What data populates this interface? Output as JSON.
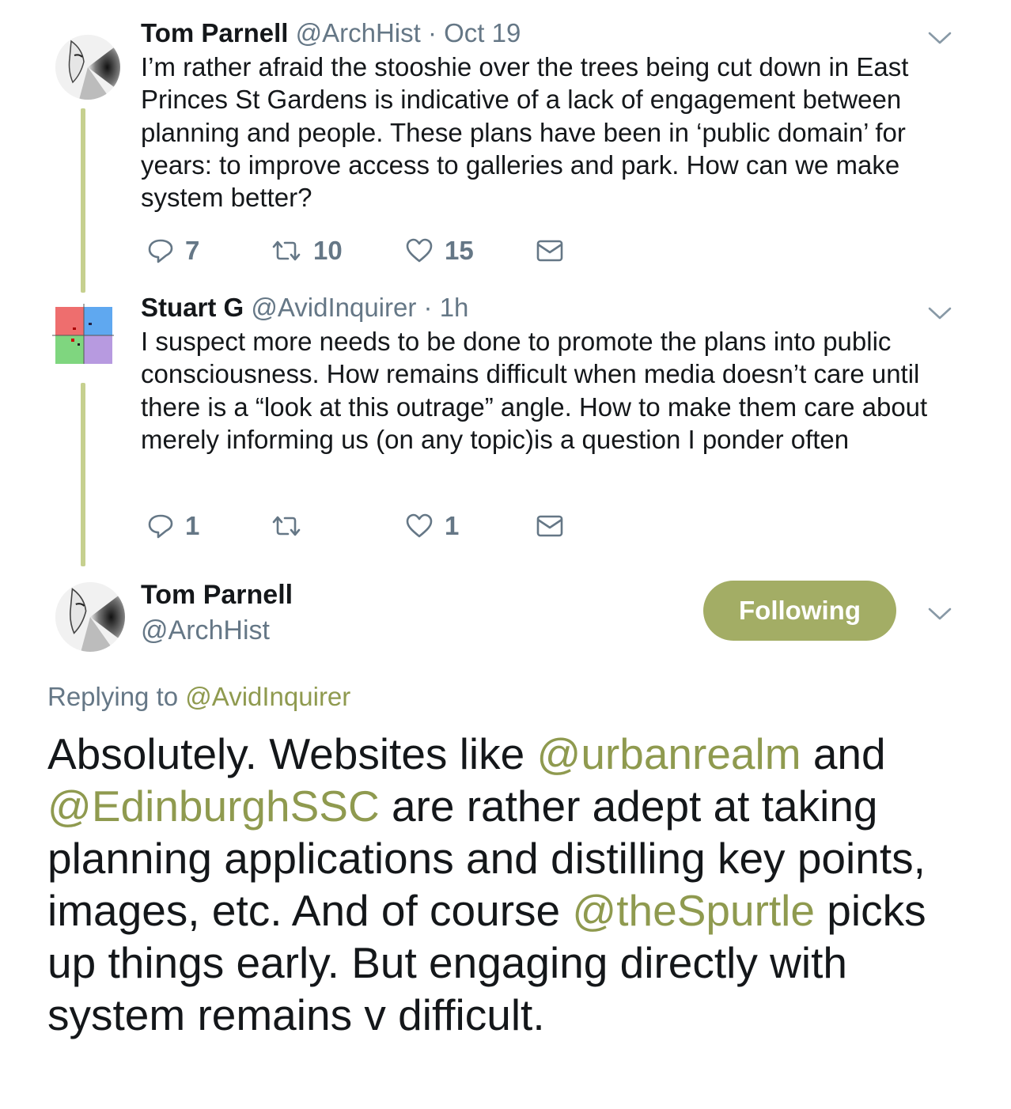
{
  "tweets": [
    {
      "name": "Tom Parnell",
      "handle": "@ArchHist",
      "date": "Oct 19",
      "text": "I’m rather afraid the stooshie over the trees being cut down in East Princes St Gardens is indicative of a lack of engagement between planning and people. These plans have been in ‘public domain’ for years: to improve access to galleries and park. How can we make system better?",
      "replies": "7",
      "retweets": "10",
      "likes": "15"
    },
    {
      "name": "Stuart G",
      "handle": "@AvidInquirer",
      "date": "1h",
      "text": "I suspect more needs to be done to promote the plans into public consciousness. How remains difficult when media doesn’t care until there is a “look at this outrage” angle. How to make them care about merely informing us (on any topic)is a question I ponder often",
      "replies": "1",
      "retweets": "",
      "likes": "1"
    }
  ],
  "main_tweet": {
    "name": "Tom Parnell",
    "handle": "@ArchHist",
    "follow_label": "Following",
    "replying_prefix": "Replying to",
    "replying_to": "@AvidInquirer",
    "text_parts": {
      "p1": "Absolutely. Websites like ",
      "m1": "@urbanrealm",
      "p2": " and ",
      "m2": "@EdinburghSSC",
      "p3": " are rather adept at taking planning applications and distilling key points, images, etc. And of course ",
      "m3": "@theSpurtle",
      "p4": " picks up things early. But engaging directly with system remains v difficult."
    }
  },
  "colors": {
    "accent": "#a3ad65",
    "mention": "#8f9a4f",
    "thread_line": "#c6d08f",
    "muted": "#657786"
  },
  "icons": [
    "reply-icon",
    "retweet-icon",
    "like-icon",
    "dm-icon",
    "chevron-down-icon"
  ]
}
